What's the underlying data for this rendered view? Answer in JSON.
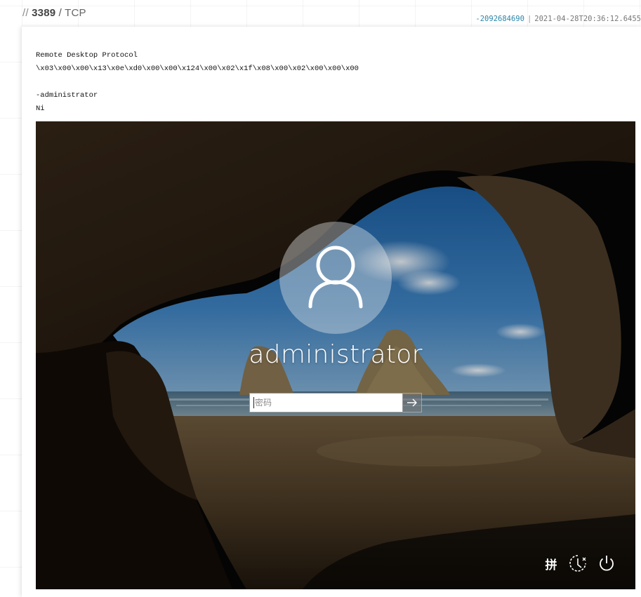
{
  "header": {
    "slashes": "//",
    "port": "3389",
    "separator": "/",
    "protocol": "TCP",
    "hash": "-2092684690",
    "meta_separator": "|",
    "timestamp": "2021-04-28T20:36:12.6455"
  },
  "banner": {
    "lines": [
      "Remote Desktop Protocol",
      "\\x03\\x00\\x00\\x13\\x0e\\xd0\\x00\\x00\\x124\\x00\\x02\\x1f\\x08\\x00\\x02\\x00\\x00\\x00",
      "",
      "-administrator",
      "Ni"
    ]
  },
  "login_screen": {
    "username": "administrator",
    "password_placeholder": "密码",
    "submit_icon": "arrow-right-icon",
    "tray": {
      "ime_label": "拼",
      "ease_of_access_icon": "ease-of-access-icon",
      "power_icon": "power-icon"
    }
  },
  "colors": {
    "hash": "#2b86a8",
    "page_background": "#ffffff",
    "screen_background": "#050505"
  }
}
